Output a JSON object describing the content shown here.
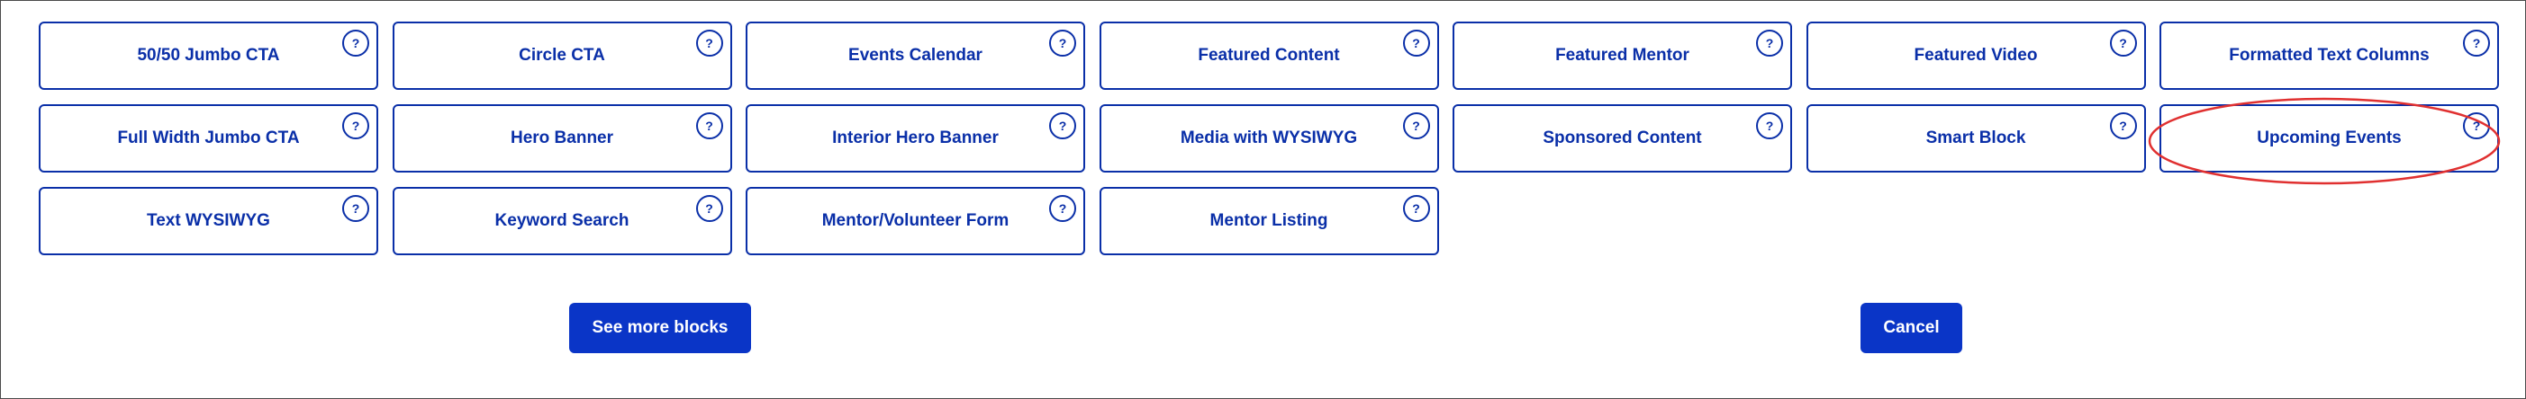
{
  "blocks": [
    {
      "label": "50/50 Jumbo CTA",
      "help": "?"
    },
    {
      "label": "Circle CTA",
      "help": "?"
    },
    {
      "label": "Events Calendar",
      "help": "?"
    },
    {
      "label": "Featured Content",
      "help": "?"
    },
    {
      "label": "Featured Mentor",
      "help": "?"
    },
    {
      "label": "Featured Video",
      "help": "?"
    },
    {
      "label": "Formatted Text Columns",
      "help": "?"
    },
    {
      "label": "Full Width Jumbo CTA",
      "help": "?"
    },
    {
      "label": "Hero Banner",
      "help": "?"
    },
    {
      "label": "Interior Hero Banner",
      "help": "?"
    },
    {
      "label": "Media with WYSIWYG",
      "help": "?"
    },
    {
      "label": "Sponsored Content",
      "help": "?"
    },
    {
      "label": "Smart Block",
      "help": "?"
    },
    {
      "label": "Upcoming Events",
      "help": "?"
    },
    {
      "label": "Text WYSIWYG",
      "help": "?"
    },
    {
      "label": "Keyword Search",
      "help": "?"
    },
    {
      "label": "Mentor/Volunteer Form",
      "help": "?"
    },
    {
      "label": "Mentor Listing",
      "help": "?"
    }
  ],
  "buttons": {
    "see_more_label": "See more blocks",
    "cancel_label": "Cancel"
  },
  "highlighted_block": "Upcoming Events",
  "colors": {
    "accent": "#0a2fa8",
    "button_bg": "#0a35c7",
    "highlight": "#e03030"
  },
  "icons": {
    "help": "question-circle-icon"
  }
}
